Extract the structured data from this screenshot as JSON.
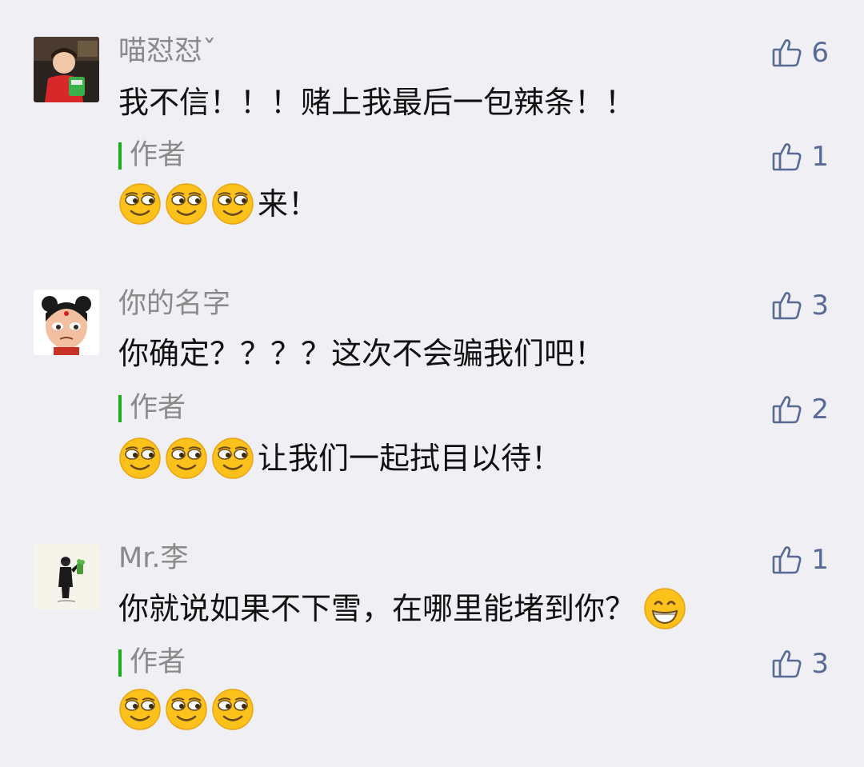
{
  "comments": [
    {
      "nickname": "喵怼怼ˇ",
      "text": "我不信！！！赌上我最后一包辣条！！",
      "likes": "6",
      "reply": {
        "label": "作者",
        "text": "来！",
        "likes": "1",
        "emoji": [
          "smirk-face-emoji",
          "smirk-face-emoji",
          "smirk-face-emoji"
        ]
      }
    },
    {
      "nickname": "你的名字",
      "text": "你确定？？？？这次不会骗我们吧！",
      "likes": "3",
      "reply": {
        "label": "作者",
        "text": "让我们一起拭目以待！",
        "likes": "2",
        "emoji": [
          "smirk-face-emoji",
          "smirk-face-emoji",
          "smirk-face-emoji"
        ]
      }
    },
    {
      "nickname": "Mr.李",
      "text": "你就说如果不下雪，在哪里能堵到你？",
      "text_emoji": "grin-face-emoji",
      "likes": "1",
      "reply": {
        "label": "作者",
        "text": "",
        "likes": "3",
        "emoji": [
          "smirk-face-emoji",
          "smirk-face-emoji",
          "smirk-face-emoji"
        ]
      }
    }
  ],
  "colors": {
    "background": "#efeff4",
    "nickname": "#8a8a8a",
    "like": "#576b95",
    "author_bar": "#1aad19"
  },
  "icons": {
    "like": "thumbs-up-icon"
  }
}
